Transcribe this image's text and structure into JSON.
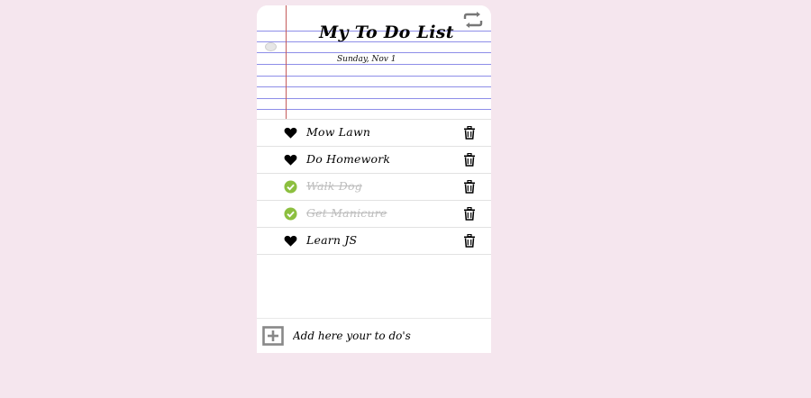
{
  "header": {
    "title": "My To Do List",
    "date": "Sunday, Nov 1",
    "repeat_icon": "repeat-icon"
  },
  "todos": [
    {
      "label": "Mow Lawn",
      "done": false,
      "icon": "heart-icon"
    },
    {
      "label": "Do Homework",
      "done": false,
      "icon": "heart-icon"
    },
    {
      "label": "Walk Dog",
      "done": true,
      "icon": "check-circle-icon"
    },
    {
      "label": "Get Manicure",
      "done": true,
      "icon": "check-circle-icon"
    },
    {
      "label": "Learn JS",
      "done": false,
      "icon": "heart-icon"
    }
  ],
  "add": {
    "placeholder": "Add here your to do's",
    "icon": "plus-square-icon"
  },
  "colors": {
    "background": "#f5e6ee",
    "check_green": "#8cbf3f",
    "done_text": "#bdbdbd",
    "ruled_line": "#8e8ee8",
    "margin_line": "#c45b5b"
  }
}
